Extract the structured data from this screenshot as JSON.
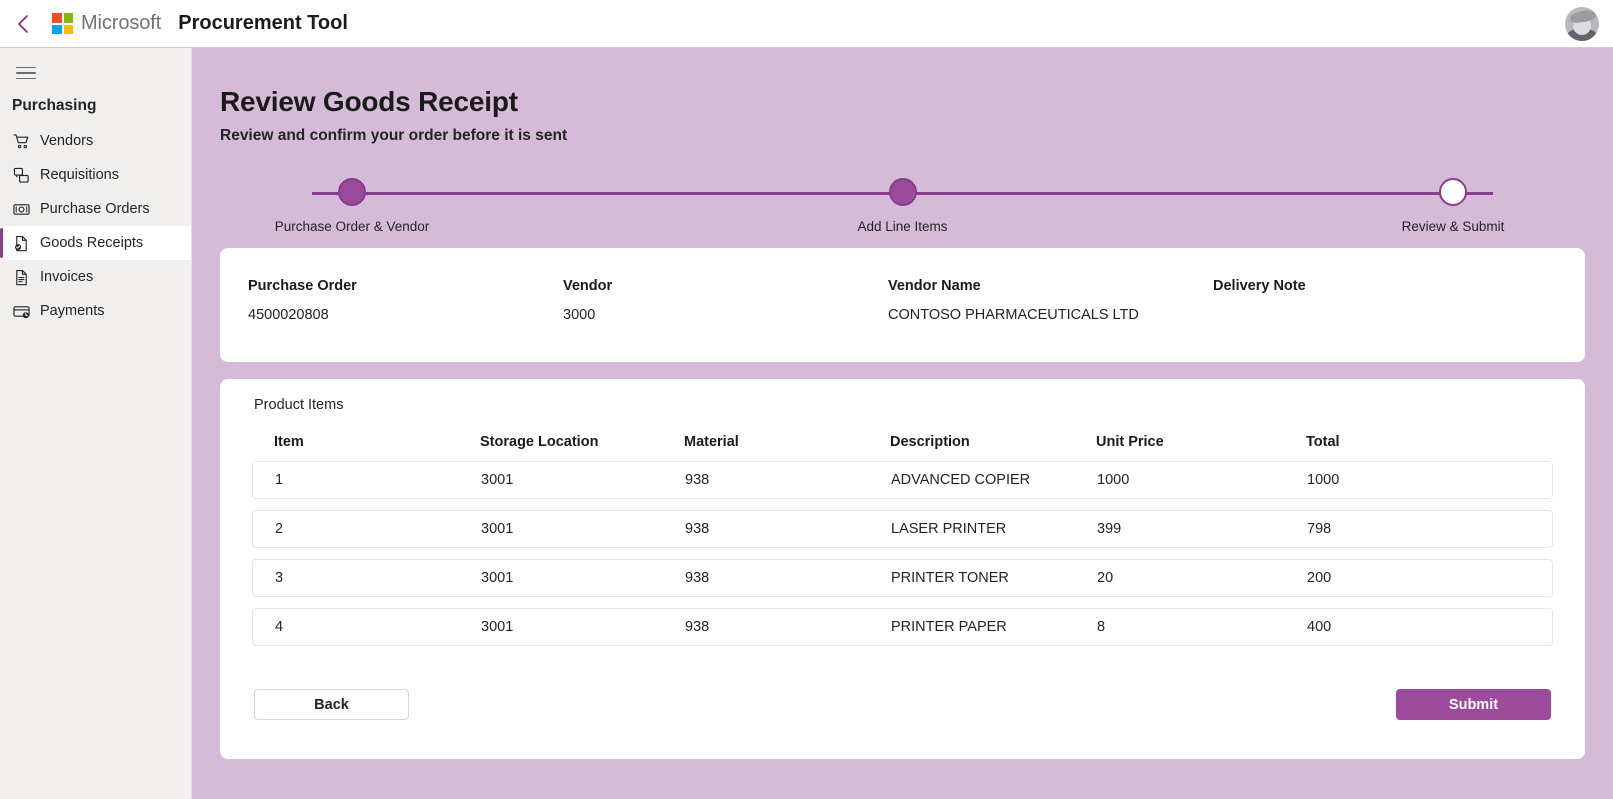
{
  "topbar": {
    "back_icon": "chevron-left-icon",
    "brand": "Microsoft",
    "app_title": "Procurement Tool",
    "avatar_icon": "user-avatar"
  },
  "sidebar": {
    "menu_icon": "hamburger-menu-icon",
    "group_title": "Purchasing",
    "items": [
      {
        "label": "Vendors",
        "icon": "shopping-cart-icon",
        "active": false
      },
      {
        "label": "Requisitions",
        "icon": "documents-icon",
        "active": false
      },
      {
        "label": "Purchase Orders",
        "icon": "money-icon",
        "active": false
      },
      {
        "label": "Goods Receipts",
        "icon": "document-check-icon",
        "active": true
      },
      {
        "label": "Invoices",
        "icon": "invoice-icon",
        "active": false
      },
      {
        "label": "Payments",
        "icon": "payment-card-icon",
        "active": false
      }
    ]
  },
  "page": {
    "title": "Review Goods Receipt",
    "subtitle": "Review and confirm your order before it is sent"
  },
  "stepper": {
    "steps": [
      {
        "label": "Purchase Order & Vendor",
        "state": "complete"
      },
      {
        "label": "Add Line Items",
        "state": "complete"
      },
      {
        "label": "Review & Submit",
        "state": "current"
      }
    ]
  },
  "info_card": {
    "fields": [
      {
        "label": "Purchase Order",
        "value": "4500020808"
      },
      {
        "label": "Vendor",
        "value": "3000"
      },
      {
        "label": "Vendor Name",
        "value": "CONTOSO PHARMACEUTICALS LTD"
      },
      {
        "label": "Delivery Note",
        "value": ""
      }
    ]
  },
  "items_card": {
    "title": "Product Items",
    "columns": [
      "Item",
      "Storage Location",
      "Material",
      "Description",
      "Unit Price",
      "Total"
    ],
    "rows": [
      {
        "item": "1",
        "location": "3001",
        "material": "938",
        "description": "ADVANCED COPIER",
        "unit_price": "1000",
        "total": "1000"
      },
      {
        "item": "2",
        "location": "3001",
        "material": "938",
        "description": "LASER PRINTER",
        "unit_price": "399",
        "total": "798"
      },
      {
        "item": "3",
        "location": "3001",
        "material": "938",
        "description": "PRINTER TONER",
        "unit_price": "20",
        "total": "200"
      },
      {
        "item": "4",
        "location": "3001",
        "material": "938",
        "description": "PRINTER PAPER",
        "unit_price": "8",
        "total": "400"
      }
    ]
  },
  "actions": {
    "back_label": "Back",
    "submit_label": "Submit"
  },
  "colors": {
    "accent_purple": "#9c4a9c",
    "accent_dark": "#8a3d8a",
    "page_background": "#d6bbd9",
    "sidebar_background": "#f0efee",
    "card_background": "#ffffff"
  }
}
